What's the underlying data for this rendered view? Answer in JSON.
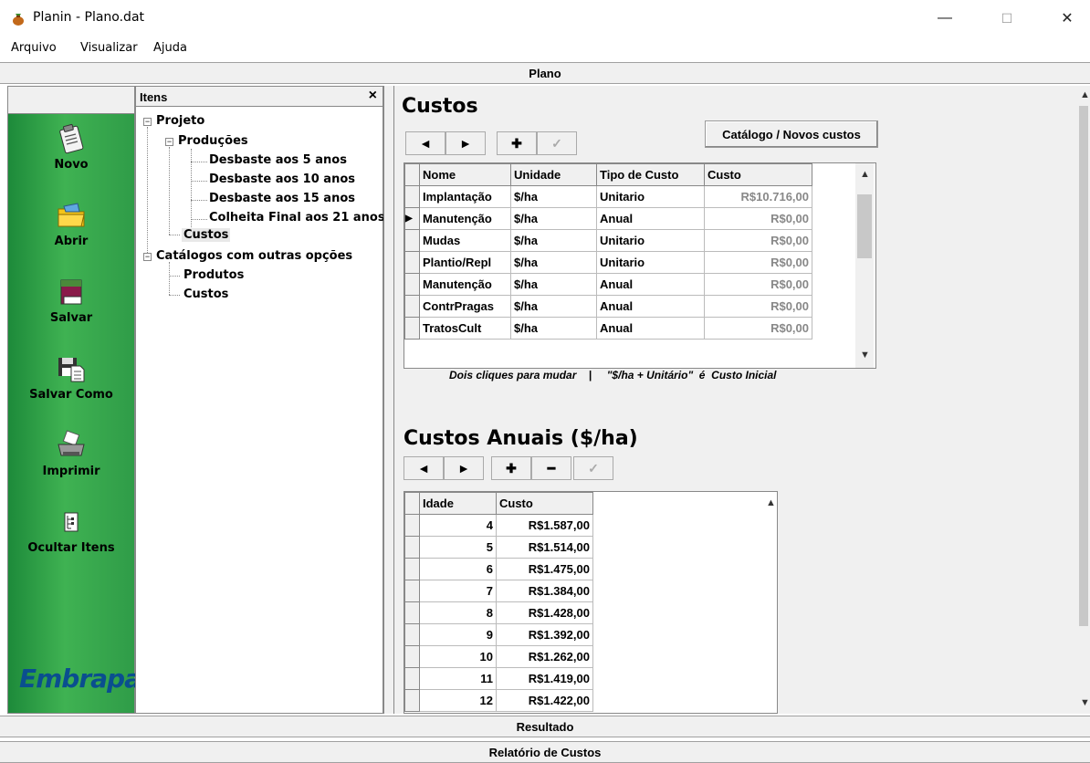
{
  "window": {
    "title": "Planin - Plano.dat",
    "minimize": "—",
    "maximize": "☐",
    "close": "✕"
  },
  "menu": [
    "Arquivo",
    "Visualizar",
    "Ajuda"
  ],
  "bands": {
    "top": "Plano",
    "result": "Resultado",
    "report": "Relatório de Custos"
  },
  "sidebar": {
    "buttons": [
      {
        "label": "Novo",
        "icon": "clipboard-icon"
      },
      {
        "label": "Abrir",
        "icon": "folder-icon"
      },
      {
        "label": "Salvar",
        "icon": "book-icon"
      },
      {
        "label": "Salvar Como",
        "icon": "floppy-icon"
      },
      {
        "label": "Imprimir",
        "icon": "printer-icon"
      },
      {
        "label": "Ocultar Itens",
        "icon": "tree-icon"
      }
    ],
    "logo": "Embrapa"
  },
  "tree": {
    "header": "Itens",
    "close": "×",
    "nodes": [
      "Projeto",
      "Produções",
      "Desbaste aos 5 anos",
      "Desbaste aos 10 anos",
      "Desbaste aos 15 anos",
      "Colheita Final aos 21 anos",
      "Custos",
      "Catálogos com outras opções",
      "Produtos",
      "Custos"
    ]
  },
  "custos": {
    "title": "Custos",
    "catalog_button": "Catálogo / Novos custos",
    "toolbar": [
      "◄",
      "►",
      "✚",
      "✓"
    ],
    "columns": [
      "Nome",
      "Unidade",
      "Tipo de Custo",
      "Custo"
    ],
    "rows": [
      {
        "nome": "Implantação",
        "unidade": "$/ha",
        "tipo": "Unitario",
        "custo": "R$10.716,00"
      },
      {
        "nome": "Manutenção",
        "unidade": "$/ha",
        "tipo": "Anual",
        "custo": "R$0,00"
      },
      {
        "nome": "Mudas",
        "unidade": "$/ha",
        "tipo": "Unitario",
        "custo": "R$0,00"
      },
      {
        "nome": "Plantio/Repl",
        "unidade": "$/ha",
        "tipo": "Unitario",
        "custo": "R$0,00"
      },
      {
        "nome": "Manutenção",
        "unidade": "$/ha",
        "tipo": "Anual",
        "custo": "R$0,00"
      },
      {
        "nome": "ContrPragas",
        "unidade": "$/ha",
        "tipo": "Anual",
        "custo": "R$0,00"
      },
      {
        "nome": "TratosCult",
        "unidade": "$/ha",
        "tipo": "Anual",
        "custo": "R$0,00"
      }
    ],
    "hint": "Dois cliques para mudar    |     \"$/ha + Unitário\"  é  Custo Inicial"
  },
  "anuais": {
    "title": "Custos Anuais ($/ha)",
    "toolbar": [
      "◄",
      "►",
      "✚",
      "━",
      "✓"
    ],
    "columns": [
      "Idade",
      "Custo"
    ],
    "rows": [
      {
        "idade": "4",
        "custo": "R$1.587,00"
      },
      {
        "idade": "5",
        "custo": "R$1.514,00"
      },
      {
        "idade": "6",
        "custo": "R$1.475,00"
      },
      {
        "idade": "7",
        "custo": "R$1.384,00"
      },
      {
        "idade": "8",
        "custo": "R$1.428,00"
      },
      {
        "idade": "9",
        "custo": "R$1.392,00"
      },
      {
        "idade": "10",
        "custo": "R$1.262,00"
      },
      {
        "idade": "11",
        "custo": "R$1.419,00"
      },
      {
        "idade": "12",
        "custo": "R$1.422,00"
      }
    ]
  }
}
